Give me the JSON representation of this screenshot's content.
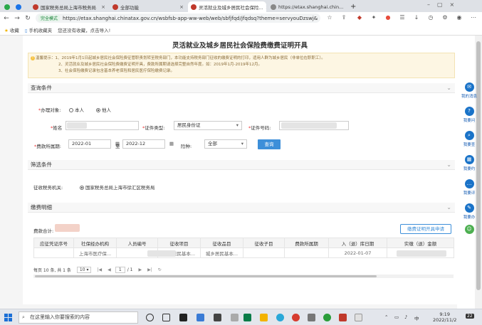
{
  "browser": {
    "tabs": [
      {
        "label": "国家税务总局上海市税务局"
      },
      {
        "label": "全部功能"
      },
      {
        "label": "灵活就业及城乡居民社会保险..."
      },
      {
        "label": "https://etax.shanghai.chin..."
      }
    ],
    "security_label": "完全模式",
    "url": "https://etax.shanghai.chinatax.gov.cn/wsbfsb-app-ww-web/web/sbfjfqd/jfqdsq?theme=servyouDzswj&",
    "bookmarks": [
      "收藏",
      "手机收藏夹",
      "您还没有收藏，点击导入!"
    ]
  },
  "page": {
    "title": "灵活就业及城乡居民社会保险费缴费证明开具",
    "notice": {
      "line1": "温馨提示：1、2019年1月1日起城乡居民社会保险费征管职责划转至税务部门，本功能支持税务部门征收的缴费证明的打印，适用人群为城乡居民（非单位在职职工）。",
      "line2": "2、灵活就业及城乡居民社会保险费缴费证明开具，费款所属期请选择完整自然年度。如：2019年1月-2019年12月。",
      "line3": "3、社会保险缴费记录包含基本养老保险和居民医疗保险缴费记录。"
    },
    "query": {
      "section_title": "查询条件",
      "target_label": "办理对象:",
      "option_self": "本人",
      "option_other": "他人",
      "name_label": "姓名",
      "doc_type_label": "证件类型:",
      "doc_type_value": "居民身份证",
      "doc_no_label": "证件号码:",
      "period_label": "费款所属期:",
      "period_from": "2022-01",
      "period_sep": "至",
      "period_to": "2022-12",
      "insurance_label": "险种:",
      "insurance_value": "全部",
      "query_button": "查询"
    },
    "filter": {
      "section_title": "筛选条件",
      "authority_label": "征收税务机关:",
      "authority_value": "国家税务总局上海市徐汇区税务局"
    },
    "details": {
      "section_title": "缴费明细",
      "total_label": "费款合计:",
      "cert_button": "缴费证明开具申请",
      "columns": [
        "应征凭证序号",
        "社保经办机构",
        "人员编号",
        "征收项目",
        "征收品目",
        "征收子目",
        "费款所属期",
        "入（退）库日期",
        "实缴（退）金额"
      ],
      "rows": [
        [
          "",
          "上海市医疗保...",
          "",
          "城乡居民基本...",
          "城乡居民基本...",
          "",
          "",
          "2022-01-07",
          ""
        ]
      ],
      "pager": {
        "summary": "每页 10 条, 共 1 条",
        "page_size": "10",
        "current_page": "1",
        "total_pages": "/ 1"
      }
    }
  },
  "side_panel": [
    {
      "label": "我的消息",
      "icon": "message-icon"
    },
    {
      "label": "我要问",
      "icon": "question-icon"
    },
    {
      "label": "我要查",
      "icon": "search-icon"
    },
    {
      "label": "我要约",
      "icon": "calendar-icon"
    },
    {
      "label": "我要评",
      "icon": "comment-icon"
    },
    {
      "label": "我要办",
      "icon": "edit-icon"
    }
  ],
  "taskbar": {
    "search_placeholder": "在这里输入你要搜索的内容",
    "time": "9:19",
    "date": "2022/11/2",
    "notification_count": "22"
  }
}
